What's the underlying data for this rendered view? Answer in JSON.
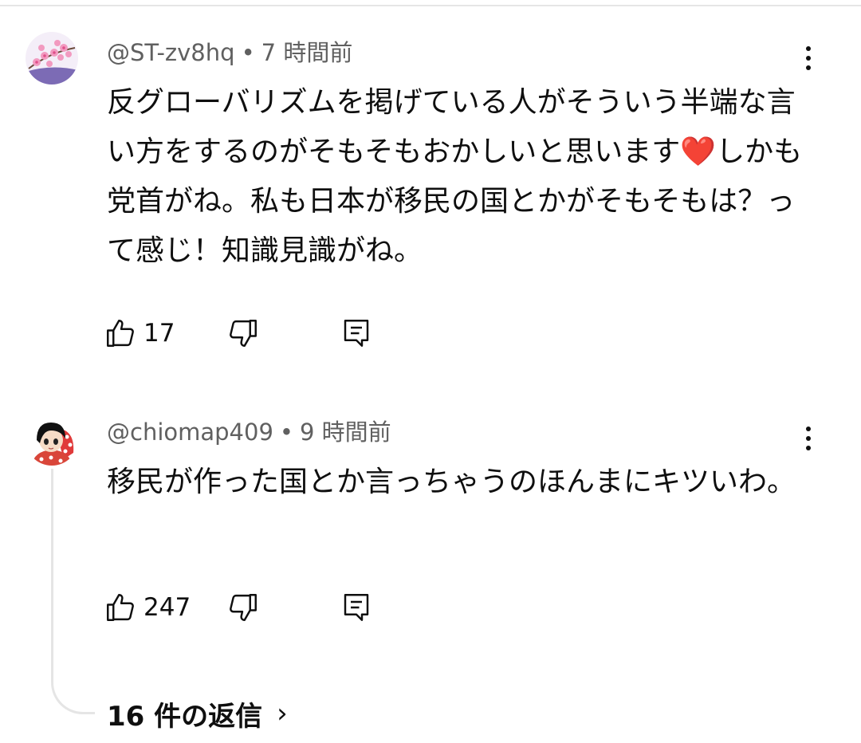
{
  "comments": [
    {
      "author": "@ST-zv8hq",
      "time": "7 時間前",
      "text": "反グローバリズムを掲げている人がそういう半端な言い方をするのがそもそもおかしいと思います❤️しかも党首がね。私も日本が移民の国とかがそもそもは？って感じ！知識見識がね。",
      "likes": "17"
    },
    {
      "author": "@chiomap409",
      "time": "9 時間前",
      "text": "移民が作った国とか言っちゃうのほんまにキツいわ。",
      "likes": "247"
    }
  ],
  "replies_label": "16 件の返信",
  "colors": {
    "meta": "#606060",
    "text": "#0f0f0f",
    "divider": "#e5e5e5"
  },
  "icons": [
    "like-icon",
    "dislike-icon",
    "reply-icon",
    "more-vert-icon",
    "chevron-right-icon"
  ]
}
